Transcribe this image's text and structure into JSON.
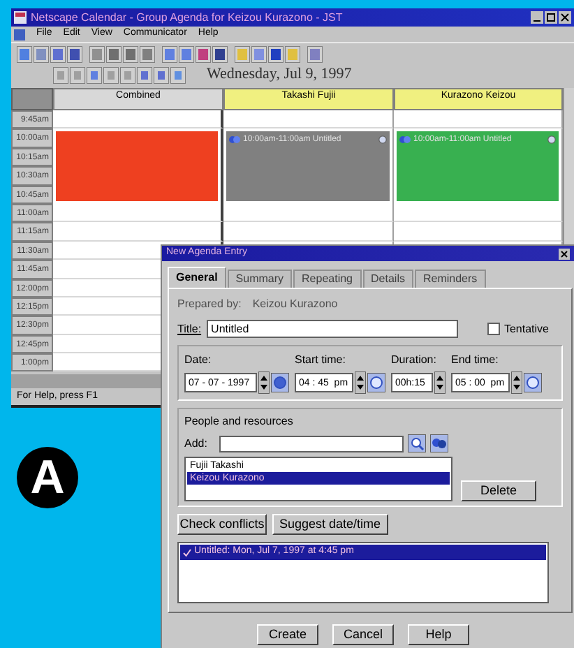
{
  "window": {
    "title": "Netscape Calendar - Group Agenda for Keizou Kurazono - JST"
  },
  "menu": [
    "File",
    "Edit",
    "View",
    "Communicator",
    "Help"
  ],
  "date_heading": "Wednesday, Jul 9, 1997",
  "columns": [
    {
      "name": "Combined",
      "highlighted": false
    },
    {
      "name": "Takashi Fujii",
      "highlighted": true
    },
    {
      "name": "Kurazono Keizou",
      "highlighted": true
    }
  ],
  "rows": [
    {
      "time": "9:45am",
      "cells": [
        {
          "kind": "empty"
        },
        {
          "kind": "empty"
        },
        {
          "kind": "empty"
        }
      ]
    },
    {
      "time": "10:00am",
      "cells": [
        {
          "kind": "event",
          "color": "#ee4020"
        },
        {
          "kind": "event_start",
          "color": "#808080",
          "text": "10:00am-11:00am Untitled"
        },
        {
          "kind": "event_start",
          "color": "#38b050",
          "text": "10:00am-11:00am Untitled"
        }
      ]
    },
    {
      "time": "10:15am",
      "cells": [
        {
          "kind": "event",
          "color": "#ee4020"
        },
        {
          "kind": "event",
          "color": "#808080"
        },
        {
          "kind": "event",
          "color": "#38b050"
        }
      ]
    },
    {
      "time": "10:30am",
      "cells": [
        {
          "kind": "event",
          "color": "#ee4020"
        },
        {
          "kind": "event",
          "color": "#808080"
        },
        {
          "kind": "event",
          "color": "#38b050"
        }
      ]
    },
    {
      "time": "10:45am",
      "cells": [
        {
          "kind": "event",
          "color": "#ee4020"
        },
        {
          "kind": "event",
          "color": "#808080"
        },
        {
          "kind": "event",
          "color": "#38b050"
        }
      ]
    },
    {
      "time": "11:00am",
      "cells": [
        {
          "kind": "empty"
        },
        {
          "kind": "empty"
        },
        {
          "kind": "empty"
        }
      ]
    },
    {
      "time": "11:15am",
      "cells": [
        {
          "kind": "empty"
        },
        {
          "kind": "empty"
        },
        {
          "kind": "empty"
        }
      ]
    },
    {
      "time": "11:30am",
      "cells": [
        {
          "kind": "empty"
        },
        {
          "kind": "empty"
        },
        {
          "kind": "empty"
        }
      ]
    },
    {
      "time": "11:45am",
      "cells": [
        {
          "kind": "empty"
        },
        {
          "kind": "covered"
        },
        {
          "kind": "covered"
        }
      ]
    },
    {
      "time": "12:00pm",
      "cells": [
        {
          "kind": "empty"
        },
        {
          "kind": "covered"
        },
        {
          "kind": "covered"
        }
      ]
    },
    {
      "time": "12:15pm",
      "cells": [
        {
          "kind": "empty"
        },
        {
          "kind": "covered"
        },
        {
          "kind": "covered"
        }
      ]
    },
    {
      "time": "12:30pm",
      "cells": [
        {
          "kind": "empty"
        },
        {
          "kind": "covered"
        },
        {
          "kind": "covered"
        }
      ]
    },
    {
      "time": "12:45pm",
      "cells": [
        {
          "kind": "empty"
        },
        {
          "kind": "covered"
        },
        {
          "kind": "covered"
        }
      ]
    },
    {
      "time": "1:00pm",
      "cells": [
        {
          "kind": "empty"
        },
        {
          "kind": "covered"
        },
        {
          "kind": "covered"
        }
      ]
    }
  ],
  "status_bar": "For Help, press F1",
  "callout": "A",
  "dialog": {
    "title": "New Agenda Entry",
    "tabs": [
      {
        "label": "General",
        "selected": true
      },
      {
        "label": "Summary",
        "selected": false
      },
      {
        "label": "Repeating",
        "selected": false
      },
      {
        "label": "Details",
        "selected": false
      },
      {
        "label": "Reminders",
        "selected": false
      }
    ],
    "prepared_by_label": "Prepared by:",
    "prepared_by": "Keizou Kurazono",
    "title_label": "Title:",
    "title_value": "Untitled",
    "tentative": {
      "label": "Tentative",
      "checked": false
    },
    "fields": [
      {
        "label": "Date:",
        "value": "07 - 07 - 1997",
        "kind": "date"
      },
      {
        "label": "Start time:",
        "value": "04 : 45  pm",
        "kind": "time"
      },
      {
        "label": "Duration:",
        "value": "00h:15",
        "kind": "plain"
      },
      {
        "label": "End time:",
        "value": "05 : 00  pm",
        "kind": "time"
      }
    ],
    "people_heading": "People and resources",
    "add_label": "Add:",
    "people": [
      {
        "name": "Fujii Takashi",
        "selected": false
      },
      {
        "name": "Keizou Kurazono",
        "selected": true
      }
    ],
    "delete_button": "Delete",
    "check_button": "Check conflicts",
    "suggest_button": "Suggest date/time",
    "results": [
      {
        "text": "Untitled: Mon, Jul 7, 1997 at 4:45 pm",
        "selected": true
      }
    ],
    "buttons": [
      "Create",
      "Cancel",
      "Help"
    ]
  }
}
